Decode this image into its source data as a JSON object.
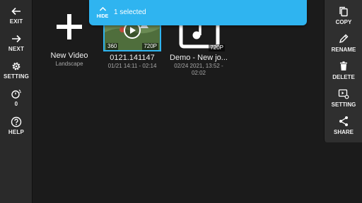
{
  "left_toolbar": {
    "exit_label": "EXIT",
    "next_label": "NEXT",
    "setting_label": "SETTING",
    "counter_value": "0",
    "help_label": "HELP"
  },
  "right_toolbar": {
    "copy_label": "COPY",
    "rename_label": "RENAME",
    "delete_label": "DELETE",
    "setting_label": "SETTING",
    "share_label": "SHARE"
  },
  "selection_banner": {
    "hide_label": "HIDE",
    "selected_text": "1 selected",
    "color": "#2fb4f0"
  },
  "tiles": {
    "new_video": {
      "title": "New Video",
      "subtitle": "Landscape"
    },
    "video_1": {
      "title": "0121.141147",
      "date_range": "01/21 14:11 - 02:14",
      "resolution": "720P",
      "badge": "360",
      "selected": true
    },
    "video_2": {
      "title": "Demo - New jo...",
      "date_line1": "02/24 2021, 13:52 -",
      "date_line2": "02:02",
      "resolution": "720P"
    }
  },
  "icons": [
    "arrow-left-icon",
    "arrow-right-icon",
    "gear-icon",
    "timer-icon",
    "help-icon",
    "copy-icon",
    "pencil-icon",
    "trash-icon",
    "video-settings-icon",
    "share-icon",
    "plus-icon",
    "play-icon",
    "music-note-icon",
    "chevron-up-icon"
  ]
}
